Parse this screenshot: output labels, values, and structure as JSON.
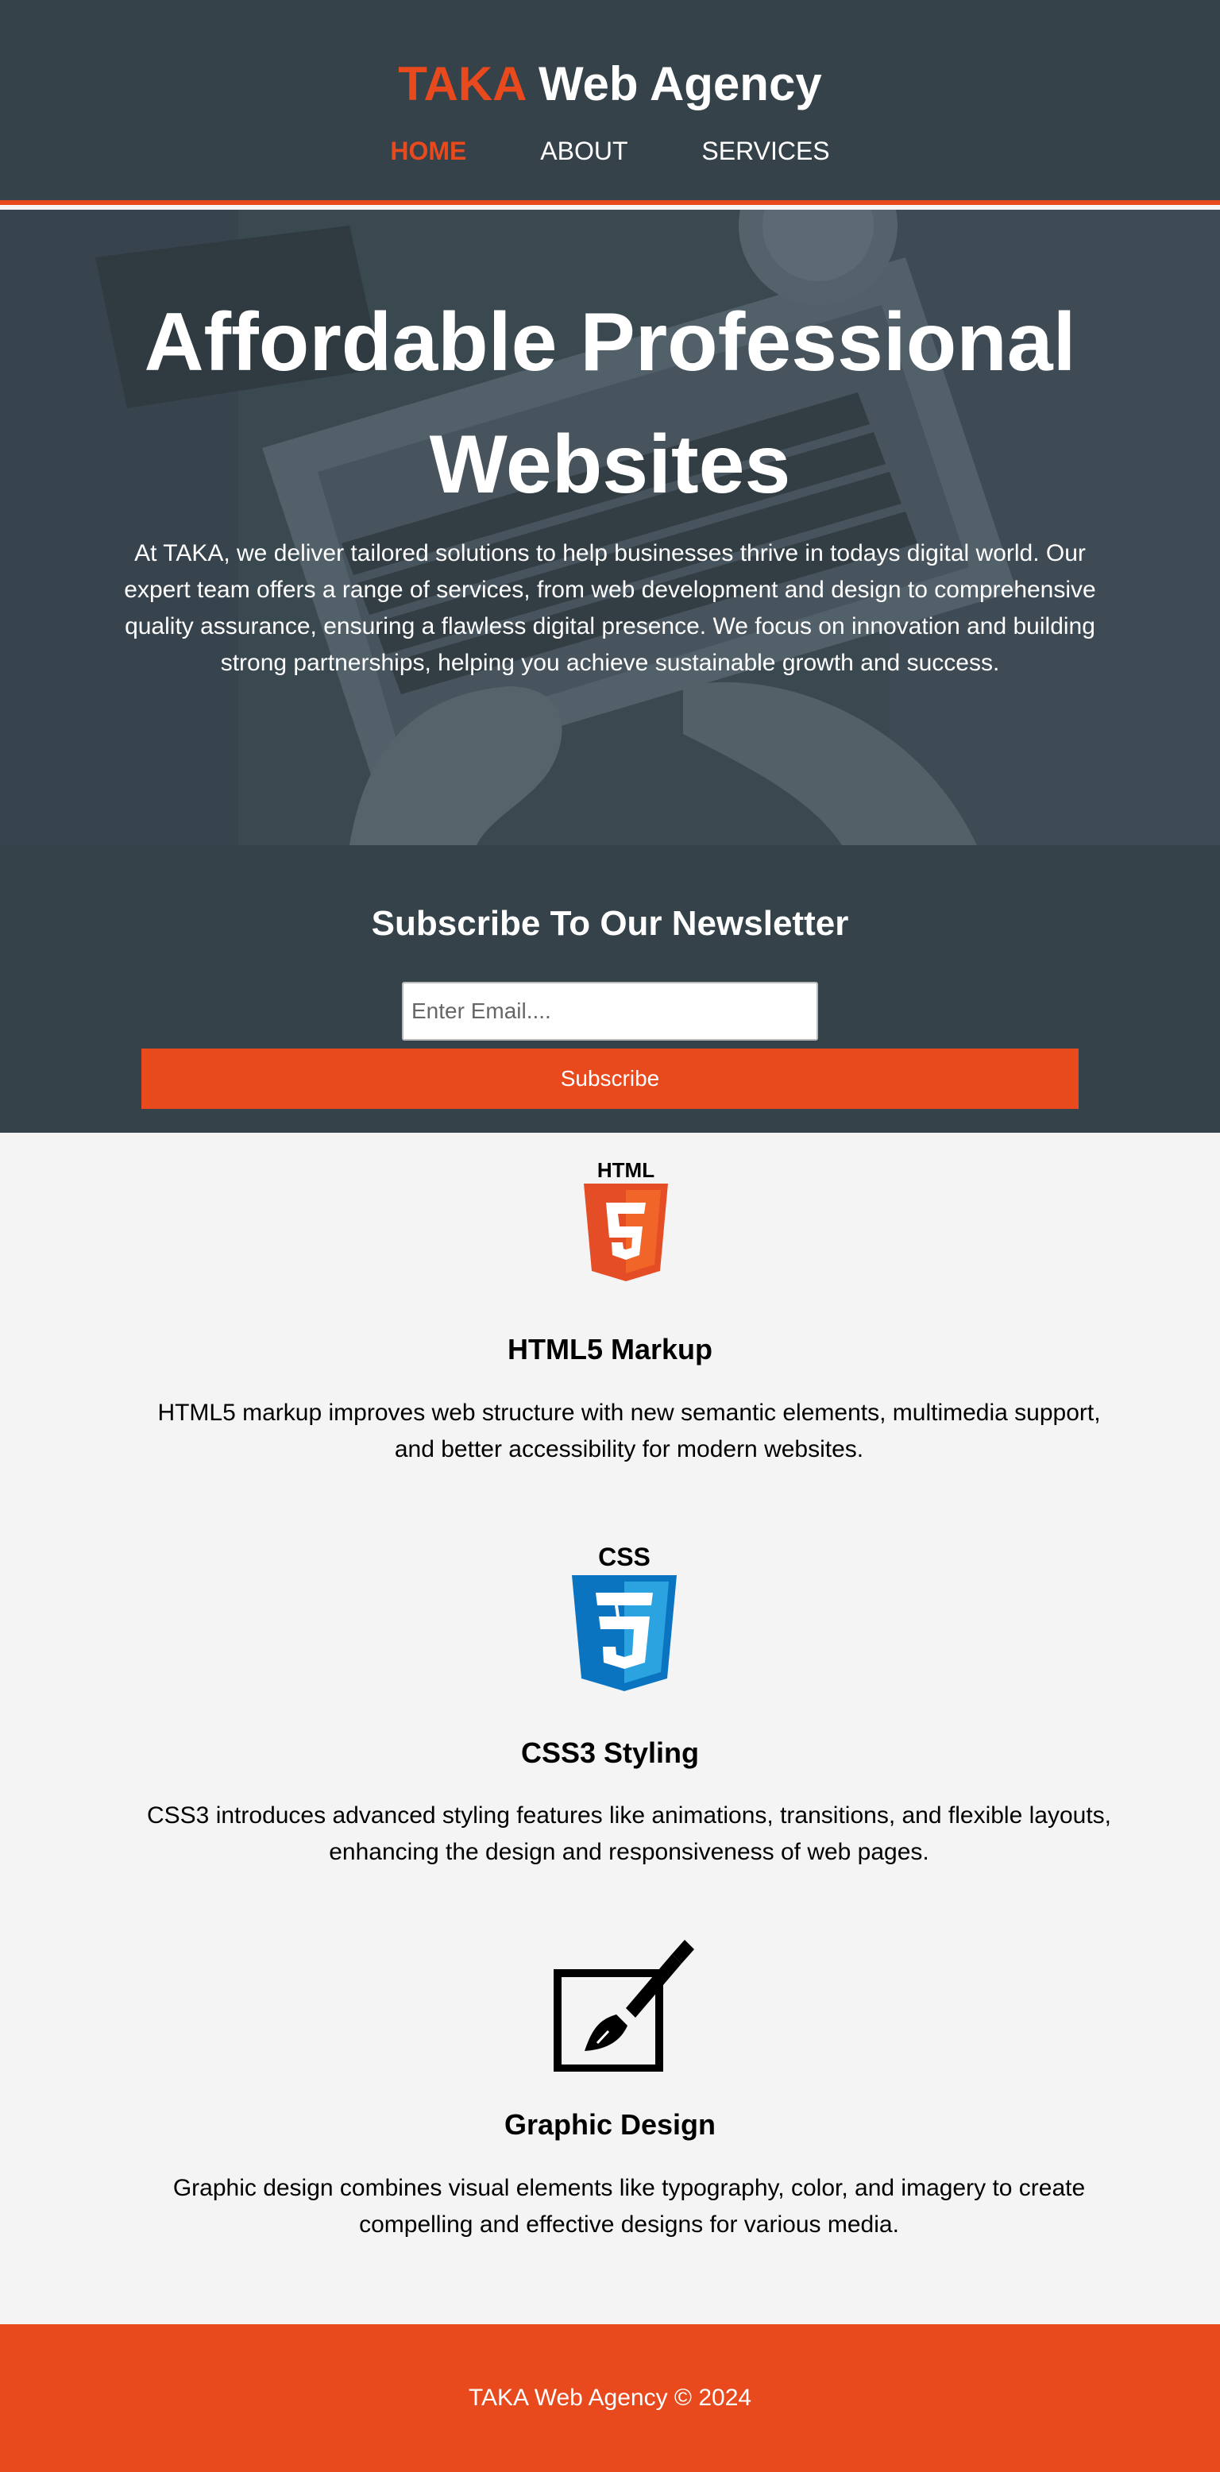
{
  "header": {
    "brand_accent": "TAKA",
    "brand_rest": "Web Agency",
    "nav": [
      {
        "label": "HOME",
        "active": true
      },
      {
        "label": "ABOUT",
        "active": false
      },
      {
        "label": "SERVICES",
        "active": false
      }
    ]
  },
  "hero": {
    "title_line1": "Affordable Professional",
    "title_line2": "Websites",
    "text": "At TAKA, we deliver tailored solutions to help businesses thrive in todays digital world. Our expert team offers a range of services, from web development and design to comprehensive quality assurance, ensuring a flawless digital presence. We focus on innovation and building strong partnerships, helping you achieve sustainable growth and success."
  },
  "newsletter": {
    "title": "Subscribe To Our Newsletter",
    "email_placeholder": "Enter Email....",
    "button_label": "Subscribe"
  },
  "boxes": [
    {
      "icon": "html5-logo-icon",
      "logo_text": "HTML",
      "title": "HTML5 Markup",
      "text": "HTML5 markup improves web structure with new semantic elements, multimedia support, and better accessibility for modern websites."
    },
    {
      "icon": "css3-logo-icon",
      "logo_text": "CSS",
      "title": "CSS3 Styling",
      "text": "CSS3 introduces advanced styling features like animations, transitions, and flexible layouts, enhancing the design and responsiveness of web pages."
    },
    {
      "icon": "graphic-design-icon",
      "title": "Graphic Design",
      "text": "Graphic design combines visual elements like typography, color, and imagery to create compelling and effective designs for various media."
    }
  ],
  "footer": {
    "text": "TAKA Web Agency © 2024"
  },
  "colors": {
    "accent": "#e8491d",
    "dark": "#35424a",
    "light": "#f4f4f4",
    "css_blue": "#0b74c1"
  }
}
